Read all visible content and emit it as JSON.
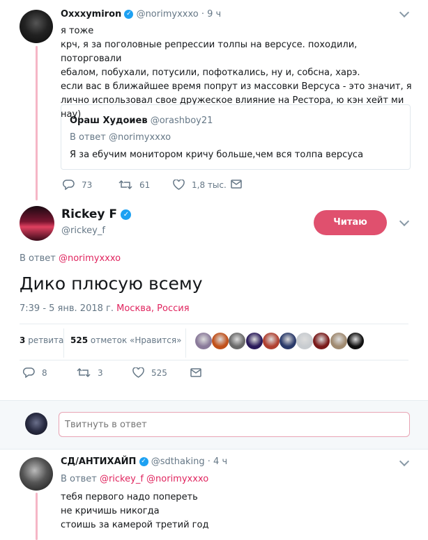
{
  "tweet1": {
    "name": "Oxxxymiron",
    "handle": "@norimyxxxo",
    "time": "· 9 ч",
    "lines": [
      "я тоже",
      "крч, я за поголовные репрессии толпы на версусе. походили, поторговали",
      "ебалом, побухали, потусили, пофоткались, ну и, собсна, харэ.",
      "если вас в ближайшее время попрут из массовки Версуса - это значит, я",
      "лично использовал свое дружеское влияние на Ресторa, ю кэн хейт ми нау)"
    ],
    "quote": {
      "name": "Ораш Худоиев",
      "handle": "@orashboy21",
      "reply_prefix": "В ответ",
      "reply_handle": "@norimyxxxo",
      "text": "Я за ебучим монитором кричу больше,чем вся толпа версуса"
    },
    "replies": "73",
    "retweets": "61",
    "likes": "1,8 тыс."
  },
  "main": {
    "name": "Rickey F",
    "handle": "@rickey_f",
    "follow_label": "Читаю",
    "reply_prefix": "В ответ",
    "reply_handle": "@norimyxxxo",
    "text": "Дико плюсую всему",
    "time": "7:39 - 5 янв. 2018 г.",
    "location": "Москва, Россия",
    "retweets_count": "3",
    "retweets_label": "ретвита",
    "likes_count": "525",
    "likes_label": "отметок «Нравится»",
    "action_replies": "8",
    "action_retweets": "3",
    "action_likes": "525",
    "liker_colors": [
      "#8a7a9a",
      "#c0501a",
      "#6a6a6a",
      "#2a1a5a",
      "#b04030",
      "#2a3a6a",
      "#c8ccd0",
      "#7a1a1a",
      "#a08a70",
      "#111111"
    ]
  },
  "reply_input": {
    "placeholder": "Твитнуть в ответ"
  },
  "tweet3": {
    "name": "СД/АНТИХАЙП",
    "handle": "@sdthaking",
    "time": "· 4 ч",
    "reply_prefix": "В ответ",
    "reply_handle1": "@rickey_f",
    "reply_handle2": "@norimyxxxo",
    "lines": [
      "тебя первого надо попереть",
      "не кричишь никогда",
      "стоишь за камерой третий год"
    ]
  }
}
